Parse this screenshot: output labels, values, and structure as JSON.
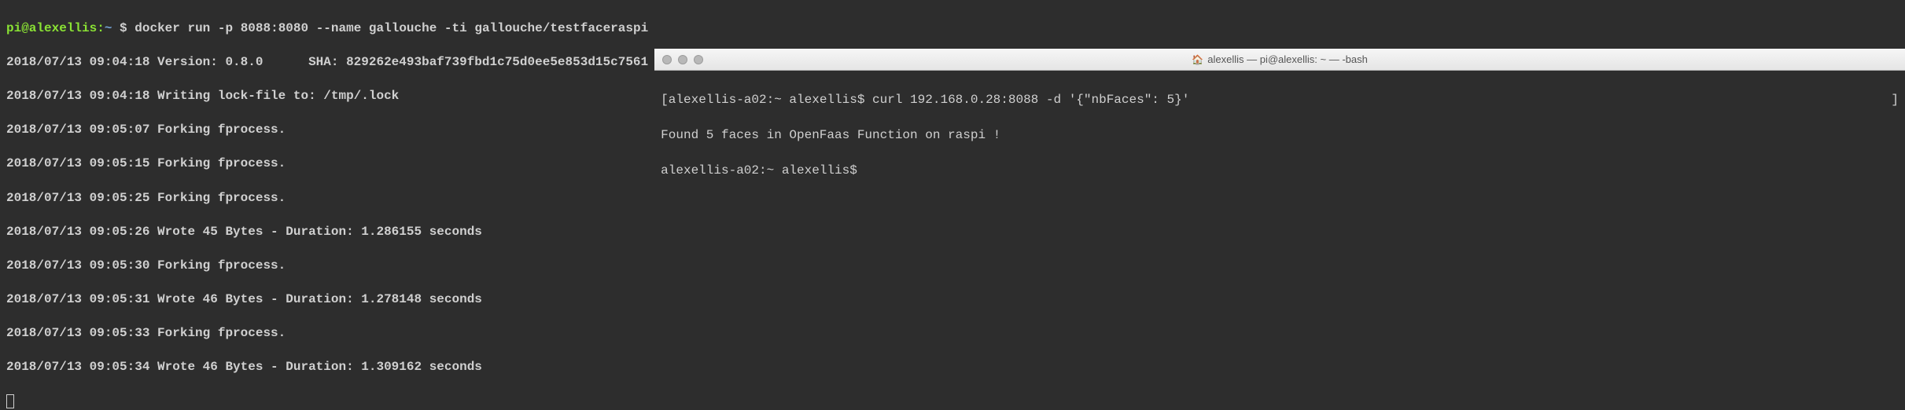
{
  "left": {
    "prompt_user": "pi@alexellis",
    "prompt_path": "~",
    "prompt_symbol": "$",
    "command": "docker run -p 8088:8080 --name gallouche -ti gallouche/testfaceraspi",
    "lines": [
      "2018/07/13 09:04:18 Version: 0.8.0\tSHA: 829262e493baf739fbd1c75d0ee5e853d15c7561",
      "2018/07/13 09:04:18 Writing lock-file to: /tmp/.lock",
      "2018/07/13 09:05:07 Forking fprocess.",
      "2018/07/13 09:05:15 Forking fprocess.",
      "2018/07/13 09:05:25 Forking fprocess.",
      "2018/07/13 09:05:26 Wrote 45 Bytes - Duration: 1.286155 seconds",
      "2018/07/13 09:05:30 Forking fprocess.",
      "2018/07/13 09:05:31 Wrote 46 Bytes - Duration: 1.278148 seconds",
      "2018/07/13 09:05:33 Forking fprocess.",
      "2018/07/13 09:05:34 Wrote 46 Bytes - Duration: 1.309162 seconds"
    ]
  },
  "right": {
    "window_title": "alexellis — pi@alexellis: ~ — -bash",
    "home_icon": "🏠",
    "prompt_host": "alexellis-a02:",
    "prompt_path": "~",
    "prompt_user": "alexellis$",
    "command": "curl 192.168.0.28:8088 -d '{\"nbFaces\": 5}'",
    "output": "Found 5 faces in OpenFaas Function on raspi !",
    "prompt2_host": "alexellis-a02:",
    "prompt2_path": "~",
    "prompt2_user": "alexellis$"
  }
}
